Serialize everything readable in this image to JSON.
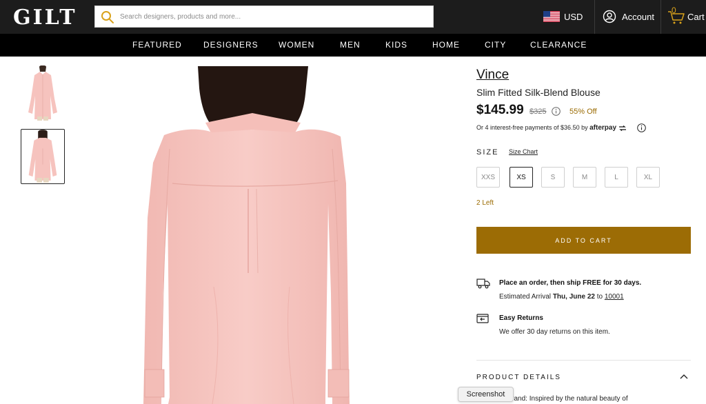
{
  "header": {
    "logo": "GILT",
    "search_placeholder": "Search designers, products and more...",
    "currency": "USD",
    "account_label": "Account",
    "cart_count": "0",
    "cart_label": "Cart"
  },
  "nav": {
    "items": [
      "FEATURED",
      "DESIGNERS",
      "WOMEN",
      "MEN",
      "KIDS",
      "HOME",
      "CITY",
      "CLEARANCE"
    ]
  },
  "product": {
    "brand": "Vince",
    "name": "Slim Fitted Silk-Blend Blouse",
    "price": "$145.99",
    "original_price": "$325",
    "discount": "55% Off",
    "afterpay_text": "Or 4 interest-free payments of $36.50 by",
    "afterpay_brand": "afterpay",
    "size_label": "SIZE",
    "size_chart_label": "Size Chart",
    "sizes": [
      "XXS",
      "XS",
      "S",
      "M",
      "L",
      "XL"
    ],
    "selected_size": "XS",
    "stock_text": "2 Left",
    "add_to_cart_label": "ADD TO CART"
  },
  "shipping": {
    "title": "Place an order, then ship FREE for 30 days.",
    "arrival_prefix": "Estimated Arrival",
    "arrival_date": "Thu, June 22",
    "to_word": "to",
    "zip": "10001"
  },
  "returns": {
    "title": "Easy Returns",
    "subtitle": "We offer 30 day returns on this item."
  },
  "details": {
    "title": "PRODUCT DETAILS",
    "about_text": "About the brand: Inspired by the natural beauty of"
  },
  "tooltip": {
    "label": "Screenshot"
  },
  "colors": {
    "accent_gold": "#9c6c05",
    "discount_text": "#9a6a00",
    "topbar_bg": "#1c1c1c",
    "nav_bg": "#000000",
    "blouse_pink": "#f6c3be"
  }
}
